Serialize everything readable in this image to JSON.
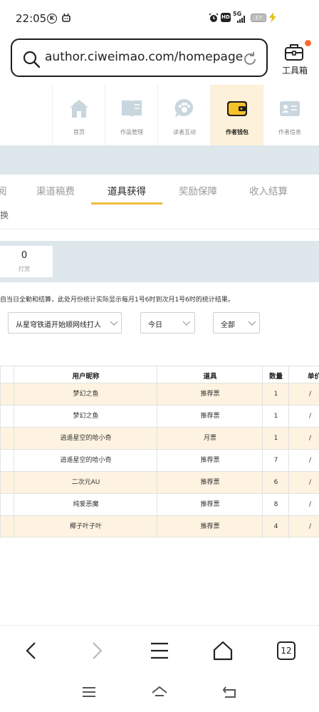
{
  "status_bar": {
    "time": "22:05",
    "icons": [
      "k-circle-icon",
      "android-icon",
      "alarm-icon",
      "hd-icon",
      "signal-5g-icon",
      "battery-icon",
      "charging-icon"
    ],
    "hd": "HD",
    "network": "5G",
    "battery": "17"
  },
  "browser": {
    "url": "author.ciweimao.com/homepage",
    "toolbox_label": "工具箱"
  },
  "nav": {
    "items": [
      {
        "label": "首页",
        "icon": "house-icon"
      },
      {
        "label": "作品管理",
        "icon": "book-icon"
      },
      {
        "label": "读者互动",
        "icon": "paw-chat-icon"
      },
      {
        "label": "作者钱包",
        "icon": "wallet-icon"
      },
      {
        "label": "作者信息",
        "icon": "id-card-icon"
      }
    ],
    "active": "作者钱包"
  },
  "tabs": {
    "items": [
      "阅",
      "渠道稿费",
      "道具获得",
      "奖励保障",
      "收入结算"
    ],
    "active": "道具获得",
    "sub": "换"
  },
  "stats": {
    "value": "0",
    "caption": "打赏"
  },
  "note": "自当日全勤和结算，此处月份统计实际显示每月1号6时到次月1号6时的统计结果。",
  "filters": {
    "book": "从星穹铁道开始顺网线打人",
    "date": "今日",
    "type": "全部"
  },
  "table": {
    "headers": [
      "",
      "用户昵称",
      "道具",
      "数量",
      "单价"
    ],
    "rows": [
      {
        "nickname": "梦幻之鱼",
        "item": "推荐票",
        "count": "1",
        "price": "/"
      },
      {
        "nickname": "梦幻之鱼",
        "item": "推荐票",
        "count": "1",
        "price": "/"
      },
      {
        "nickname": "逍遥星空的哈小奇",
        "item": "月票",
        "count": "1",
        "price": "/"
      },
      {
        "nickname": "逍遥星空的哈小奇",
        "item": "推荐票",
        "count": "7",
        "price": "/"
      },
      {
        "nickname": "二次元AU",
        "item": "推荐票",
        "count": "6",
        "price": "/"
      },
      {
        "nickname": "纯爱恶魔",
        "item": "推荐票",
        "count": "8",
        "price": "/"
      },
      {
        "nickname": "椰子叶子叶",
        "item": "推荐票",
        "count": "4",
        "price": "/"
      }
    ]
  },
  "bottom_bar": {
    "tab_count": "12"
  },
  "colors": {
    "accent": "#f0bb3c",
    "alt_row": "#fdf3e0",
    "band": "#dde7ec",
    "badge": "#ff6b35",
    "active_nav_bg": "#fdf1d9"
  }
}
